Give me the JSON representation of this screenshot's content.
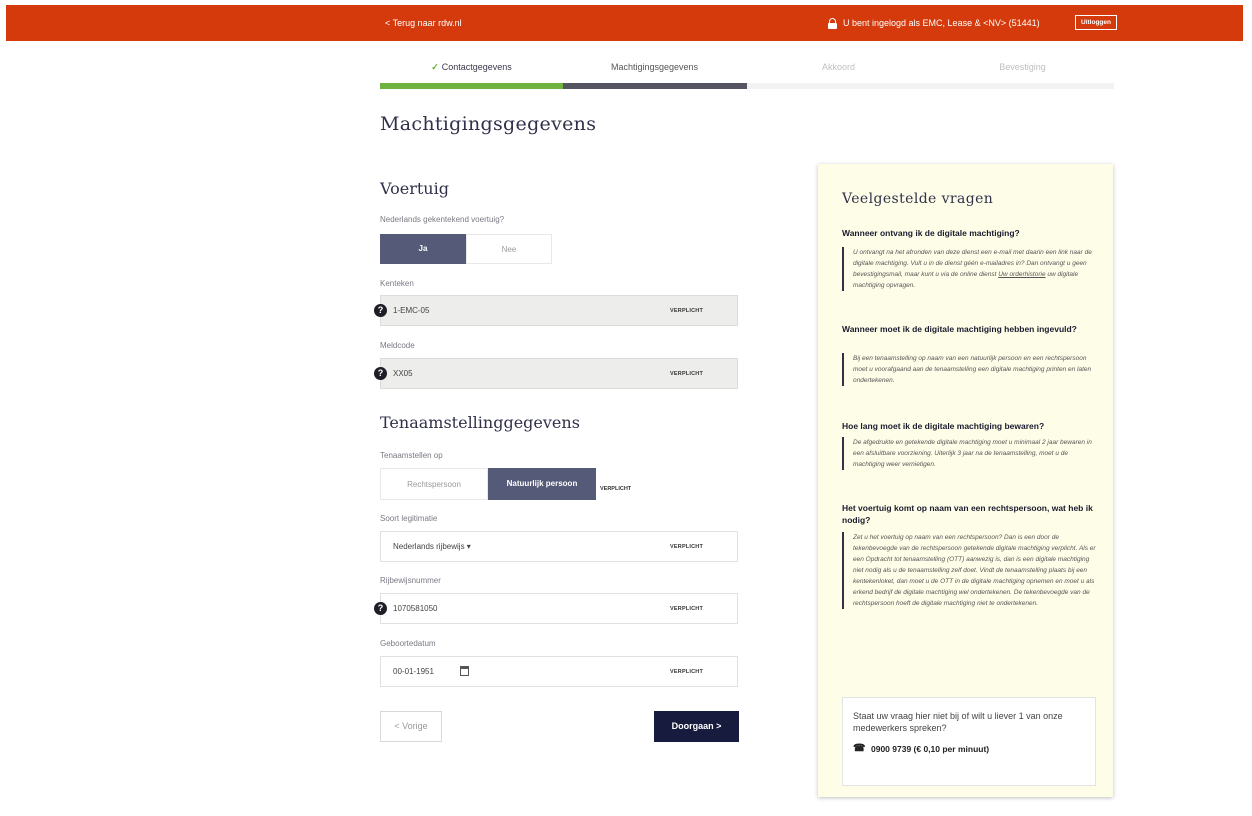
{
  "header": {
    "back_label": "< Terug naar rdw.nl",
    "login_text": "U bent ingelogd als EMC, Lease & <NV> (51441)",
    "logout_label": "Uitloggen"
  },
  "steps": [
    {
      "label": "Contactgegevens",
      "state": "done"
    },
    {
      "label": "Machtigingsgegevens",
      "state": "active"
    },
    {
      "label": "Akkoord",
      "state": "future"
    },
    {
      "label": "Bevestiging",
      "state": "future"
    }
  ],
  "progress": {
    "completed_steps": 2,
    "total_steps": 4
  },
  "page_title": "Machtigingsgegevens",
  "vehicle": {
    "heading": "Voertuig",
    "question": "Nederlands gekentekend voertuig?",
    "yes_label": "Ja",
    "no_label": "Nee",
    "selected": "Ja",
    "plate_label": "Kenteken",
    "plate_value": "1-EMC-05",
    "code_label": "Meldcode",
    "code_value": "XX05"
  },
  "registration": {
    "heading": "Tenaamstellinggegevens",
    "type_label": "Tenaamstellen op",
    "option_company": "Rechtspersoon",
    "option_person": "Natuurlijk persoon",
    "selected": "Natuurlijk persoon",
    "id_type_label": "Soort legitimatie",
    "id_type_value": "Nederlands rijbewijs ▾",
    "license_label": "Rijbewijsnummer",
    "license_value": "1070581050",
    "dob_label": "Geboortedatum",
    "dob_value": "00-01-1951"
  },
  "required_label": "VERPLICHT",
  "buttons": {
    "prev": "< Vorige",
    "next": "Doorgaan  >"
  },
  "faq": {
    "title": "Veelgestelde vragen",
    "items": [
      {
        "q": "Wanneer ontvang ik de digitale machtiging?",
        "a_pre": "U ontvangt na het afronden van deze dienst een e-mail met daarin een link naar de digitale machtiging. Vult u in de dienst géén e-mailadres in? Dan ontvangt u geen bevestigingsmail, maar kunt u via de online dienst ",
        "a_link": "Uw orderhistorie",
        "a_post": " uw digitale machtiging opvragen."
      },
      {
        "q": "Wanneer moet ik de digitale machtiging hebben ingevuld?",
        "a": "Bij een tenaamstelling op naam van een natuurlijk persoon en een rechtspersoon moet u voorafgaand aan de tenaamstelling een digitale machtiging printen en laten ondertekenen."
      },
      {
        "q": "Hoe lang moet ik de digitale machtiging bewaren?",
        "a": "De afgedrukte en getekende digitale machtiging moet u minimaal 2 jaar bewaren in een afsluitbare voorziening. Uiterlijk 3 jaar na de tenaamstelling, moet u de machtiging weer vernietigen."
      },
      {
        "q": "Het voertuig komt op naam van een rechtspersoon, wat heb ik nodig?",
        "a": "Zet u het voertuig op naam van een rechtspersoon? Dan is een door de tekenbevoegde van de rechtspersoon getekende digitale machtiging verplicht. Als er een Opdracht tot tenaamstelling (OTT) aanwezig is, dan is een digitale machtiging niet nodig als u de tenaamstelling zelf doet. Vindt de tenaamstelling plaats bij een kentekenloket, dan moet u de OTT in de digitale machtiging opnemen en moet u als erkend bedrijf de digitale machtiging wel ondertekenen. De tekenbevoegde van de rechtspersoon hoeft de digitale machtiging niet te ondertekenen."
      }
    ],
    "contact_text": "Staat uw vraag hier niet bij of wilt u liever 1 van onze medewerkers spreken?",
    "contact_phone": "0900 9739 (€ 0,10 per minuut)"
  }
}
